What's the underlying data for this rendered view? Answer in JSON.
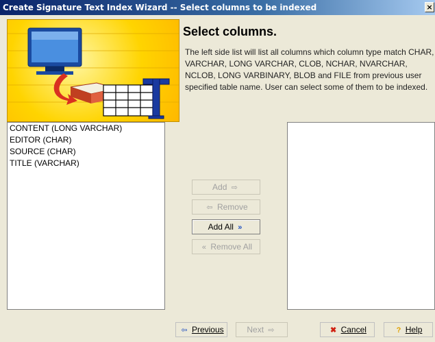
{
  "window": {
    "title": "Create Signature Text Index Wizard -- Select columns to be indexed",
    "close_symbol": "×"
  },
  "header": {
    "heading": "Select columns.",
    "description": "The left side list will list all columns which column type match CHAR, VARCHAR, LONG VARCHAR, CLOB, NCHAR, NVARCHAR, NCLOB, LONG VARBINARY, BLOB and FILE from previous user specified table name. User can select some of them to be indexed."
  },
  "available_columns": [
    "CONTENT (LONG VARCHAR)",
    "EDITOR (CHAR)",
    "SOURCE (CHAR)",
    "TITLE (VARCHAR)"
  ],
  "selected_columns": [],
  "transfer_buttons": {
    "add": "Add",
    "remove": "Remove",
    "add_all": "Add All",
    "remove_all": "Remove All"
  },
  "nav_buttons": {
    "previous": "Previous",
    "next": "Next",
    "cancel": "Cancel",
    "help": "Help"
  },
  "icons": {
    "add": "arrow-right-icon",
    "remove": "arrow-left-icon",
    "add_all": "double-arrow-right-icon",
    "remove_all": "double-arrow-left-icon",
    "previous": "previous-arrow-icon",
    "next": "next-arrow-icon",
    "cancel": "red-x-icon",
    "help": "question-mark-icon"
  },
  "colors": {
    "title_bar": "#0a246a",
    "banner": "#ffd400",
    "window_bg": "#ece9d8",
    "accent_blue": "#2050c0"
  }
}
